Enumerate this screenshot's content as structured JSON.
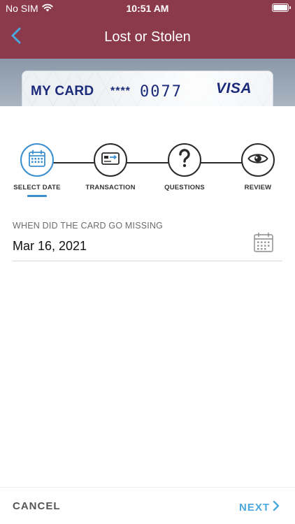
{
  "status_bar": {
    "carrier": "No SIM",
    "time": "10:51 AM"
  },
  "nav": {
    "title": "Lost or Stolen"
  },
  "card": {
    "name": "MY CARD",
    "mask": "****",
    "last_digits": "0077",
    "brand": "VISA"
  },
  "stepper": {
    "steps": [
      {
        "label": "SELECT DATE",
        "icon": "calendar-icon",
        "active": true
      },
      {
        "label": "TRANSACTION",
        "icon": "credit-card-icon",
        "active": false
      },
      {
        "label": "QUESTIONS",
        "icon": "question-mark-icon",
        "active": false
      },
      {
        "label": "REVIEW",
        "icon": "eye-icon",
        "active": false
      }
    ]
  },
  "date_field": {
    "label": "WHEN DID THE CARD GO MISSING",
    "value": "Mar 16, 2021"
  },
  "footer": {
    "cancel_label": "CANCEL",
    "next_label": "NEXT"
  },
  "colors": {
    "header": "#8b3a4b",
    "accent": "#3b8fcf",
    "card_text": "#1c2a7a",
    "next": "#4aa8df"
  }
}
